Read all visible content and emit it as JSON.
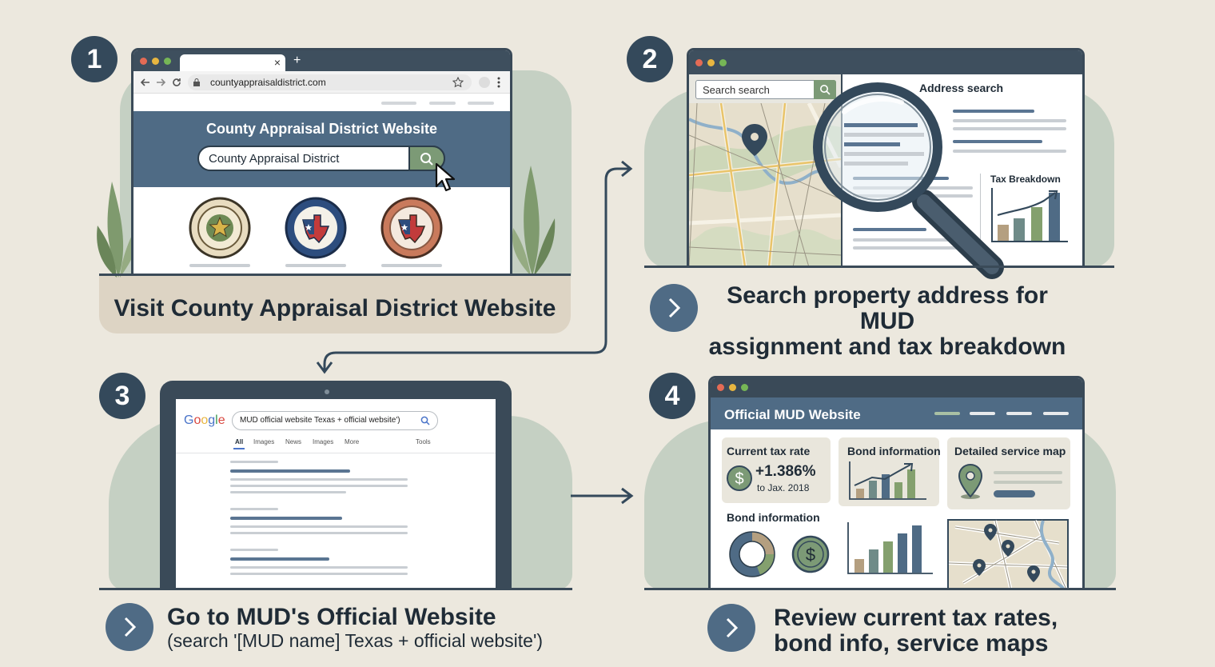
{
  "step1": {
    "number": "1",
    "browser_url": "countyappraisaldistrict.com",
    "tab_close": "×",
    "tab_new": "+",
    "banner_title": "County Appraisal District Website",
    "search_value": "County Appraisal District",
    "caption": "Visit County Appraisal District Website"
  },
  "step2": {
    "number": "2",
    "search_value": "Search search",
    "panel_title": "Address search",
    "tax_breakdown_label": "Tax Breakdown",
    "caption_line1": "Search property address for MUD",
    "caption_line2": "assignment and tax breakdown"
  },
  "step3": {
    "number": "3",
    "google_logo": "Google",
    "search_query": "MUD official website Texas + official website')",
    "tabs": [
      "All",
      "Images",
      "News",
      "Images",
      "More"
    ],
    "tools": "Tools",
    "caption_line1": "Go to MUD's Official Website",
    "caption_line2": "(search '[MUD name] Texas + official website')"
  },
  "step4": {
    "number": "4",
    "window_title": "Official MUD Website",
    "tax_rate_title": "Current tax rate",
    "tax_rate_value": "+1.386%",
    "tax_rate_note": "to Jax. 2018",
    "bond_title_top": "Bond information",
    "service_map_title": "Detailed service map",
    "bond_title_bottom": "Bond information",
    "caption_line1": "Review current tax rates,",
    "caption_line2": "bond info, service maps"
  },
  "colors": {
    "background": "#ece8de",
    "navy": "#34495b",
    "slate_blue": "#4f6b85",
    "sage": "#c5d0c3",
    "card": "#e9e6dc"
  }
}
